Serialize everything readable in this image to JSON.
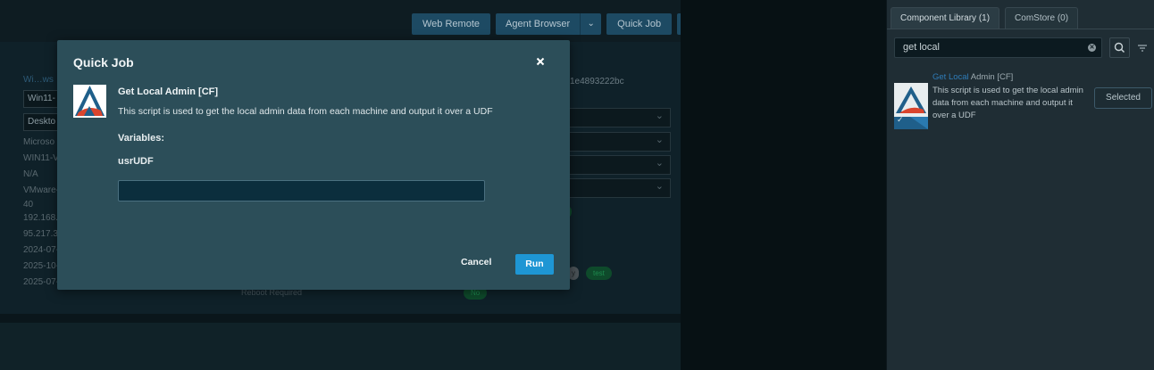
{
  "toolbar": {
    "web_remote": "Web Remote",
    "agent_browser": "Agent Browser",
    "quick_job": "Quick Job"
  },
  "background": {
    "link_text": "Wi…ws",
    "field1": "Win11-",
    "field2": "Deskto",
    "values": [
      "Microso",
      "WIN11-V",
      "N/A",
      "VMware-",
      "40",
      "192.168.",
      "95.217.3",
      "2024-07-",
      "2025-10-",
      "2025-07-"
    ],
    "hash_fragment": "1e4893222bc",
    "reboot_label": "Reboot Required",
    "pill_no": "No",
    "pill_gray": "y",
    "pill_green": "test"
  },
  "sidebar": {
    "tabs": [
      {
        "label": "Component Library (1)",
        "active": true
      },
      {
        "label": "ComStore (0)",
        "active": false
      }
    ],
    "search": {
      "value": "get local",
      "placeholder": ""
    },
    "result": {
      "title_highlight": "Get Local",
      "title_rest": " Admin [CF]",
      "description": "This script is used to get the local admin data from each machine and output it over a UDF",
      "button": "Selected"
    }
  },
  "modal": {
    "title": "Quick Job",
    "job_name": "Get Local Admin [CF]",
    "job_description": "This script is used to get the local admin data from each machine and output it over a UDF",
    "variables_label": "Variables:",
    "variable_name": "usrUDF",
    "variable_value": "",
    "cancel": "Cancel",
    "run": "Run"
  },
  "colors": {
    "accent": "#1e96d4",
    "modal_bg": "#2c4e59",
    "highlight": "#2f7cb8"
  }
}
